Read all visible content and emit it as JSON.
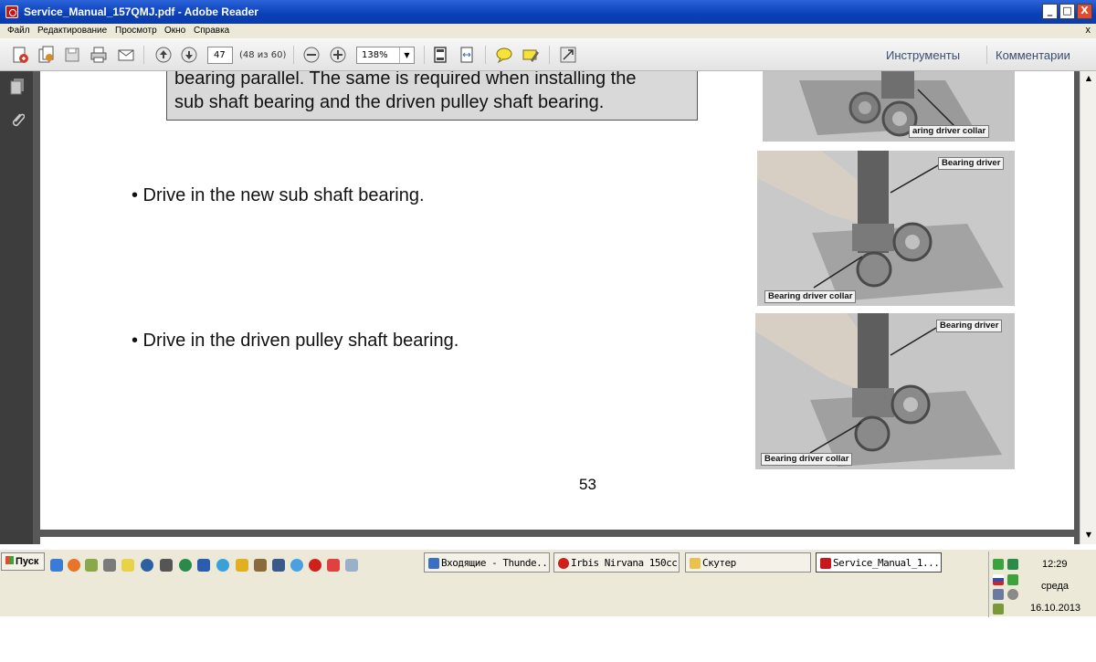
{
  "window": {
    "title": "Service_Manual_157QMJ.pdf - Adobe Reader",
    "buttons": {
      "minimize": "_",
      "maximize": "□",
      "close": "X"
    }
  },
  "menu": {
    "items": [
      "Файл",
      "Редактирование",
      "Просмотр",
      "Окно",
      "Справка"
    ],
    "close_doc": "x"
  },
  "toolbar": {
    "page_value": "47",
    "page_count": "(48 из 60)",
    "zoom_value": "138%",
    "tools_label": "Инструменты",
    "comments_label": "Комментарии"
  },
  "document": {
    "note_lines": [
      "bearing parallel. The same is required when installing the",
      "sub shaft bearing and the driven pulley shaft bearing."
    ],
    "bullets": [
      "• Drive in the new sub shaft bearing.",
      "• Drive in the driven pulley shaft bearing."
    ],
    "page_number": "53",
    "photos": [
      {
        "captions": [
          "aring driver collar"
        ]
      },
      {
        "captions": [
          "Bearing driver",
          "Bearing driver collar"
        ]
      },
      {
        "captions": [
          "Bearing driver",
          "Bearing driver collar"
        ]
      }
    ]
  },
  "taskbar": {
    "start_label": "Пуск",
    "tasks": [
      {
        "label": "Входящие - Thunde...",
        "color": "#3b6fc4"
      },
      {
        "label": "Irbis Nirvana 150cc ...",
        "color": "#d0201c"
      },
      {
        "label": "Скутер",
        "color": "#e8c24a"
      },
      {
        "label": "Service_Manual_1...",
        "color": "#c8161d"
      }
    ],
    "clock": {
      "time": "12:29",
      "day": "среда",
      "date": "16.10.2013"
    }
  }
}
